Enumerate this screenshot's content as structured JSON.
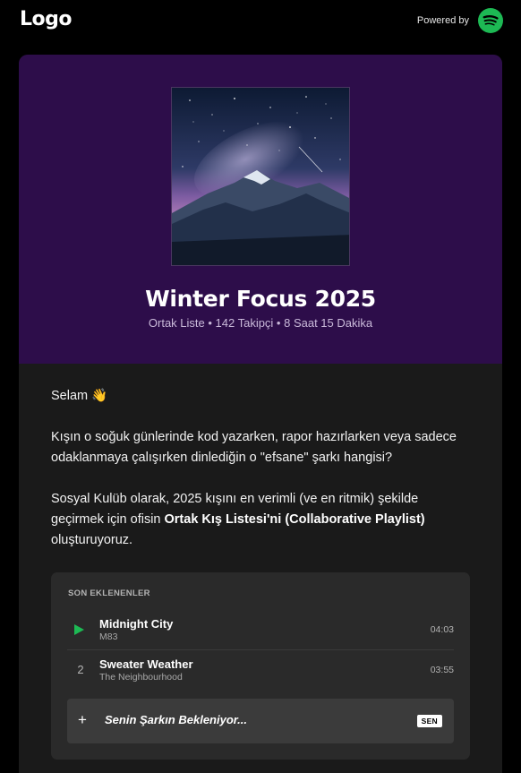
{
  "header": {
    "logo": "Logo",
    "powered_by": "Powered by",
    "brand_icon": "spotify-icon"
  },
  "playlist": {
    "title": "Winter Focus 2025",
    "meta": "Ortak Liste • 142 Takipçi • 8 Saat 15 Dakika",
    "cover_icon": "mountain-night-sky-image"
  },
  "message": {
    "greeting": "Selam 👋",
    "p1": "Kışın o soğuk günlerinde kod yazarken, rapor hazırlarken veya sadece odaklanmaya çalışırken dinlediğin o \"efsane\" şarkı hangisi?",
    "p2_before": "Sosyal Kulüb olarak, 2025 kışını en verimli (ve en ritmik) şekilde geçirmek için ofisin ",
    "p2_bold": "Ortak Kış Listesi'ni (Collaborative Playlist)",
    "p2_after": " oluşturuyoruz."
  },
  "recent": {
    "heading": "SON EKLENENLER",
    "tracks": [
      {
        "index": "1",
        "name": "Midnight City",
        "artist": "M83",
        "duration": "04:03",
        "playing": true
      },
      {
        "index": "2",
        "name": "Sweater Weather",
        "artist": "The Neighbourhood",
        "duration": "03:55",
        "playing": false
      }
    ],
    "add_label": "Senin Şarkın Bekleniyor...",
    "add_badge": "SEN"
  },
  "colors": {
    "background": "#000000",
    "hero": "#2d0d4a",
    "card": "#1a1a1a",
    "panel": "#2a2a2a",
    "accent": "#1db954"
  }
}
